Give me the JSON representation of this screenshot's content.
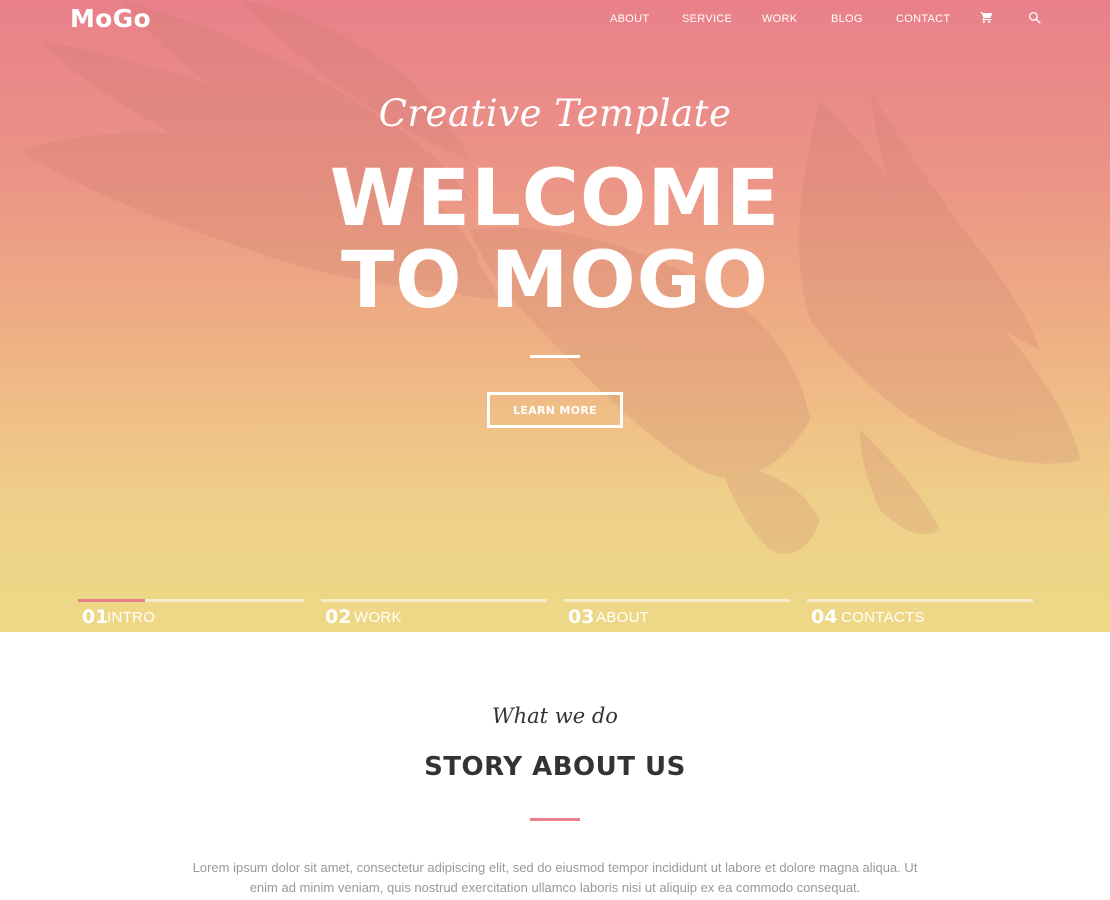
{
  "header": {
    "logo": "MoGo",
    "nav": [
      {
        "label": "ABOUT"
      },
      {
        "label": "SERVICE"
      },
      {
        "label": "WORK"
      },
      {
        "label": "BLOG"
      },
      {
        "label": "CONTACT"
      }
    ],
    "icons": [
      "cart-icon",
      "search-icon"
    ]
  },
  "hero": {
    "subtitle": "Creative Template",
    "title_line1": "WELCOME",
    "title_line2": "TO MOGO",
    "button_label": "LEARN MORE",
    "background_image": "eagle-icon",
    "gradient": [
      "#e9808a",
      "#eed986"
    ]
  },
  "slider": {
    "tabs": [
      {
        "number": "01",
        "label": "INTRO",
        "active": true
      },
      {
        "number": "02",
        "label": "WORK",
        "active": false
      },
      {
        "number": "03",
        "label": "ABOUT",
        "active": false
      },
      {
        "number": "04",
        "label": "CONTACTS",
        "active": false
      }
    ]
  },
  "about": {
    "kicker": "What we do",
    "title": "STORY ABOUT US",
    "text": "Lorem ipsum dolor sit amet, consectetur adipiscing elit, sed do eiusmod tempor incididunt ut labore et dolore magna aliqua. Ut enim ad minim veniam, quis nostrud exercitation ullamco laboris nisi ut aliquip ex ea commodo consequat."
  },
  "colors": {
    "accent": "#e9808a",
    "text_dark": "#333333",
    "text_muted": "#999999"
  }
}
